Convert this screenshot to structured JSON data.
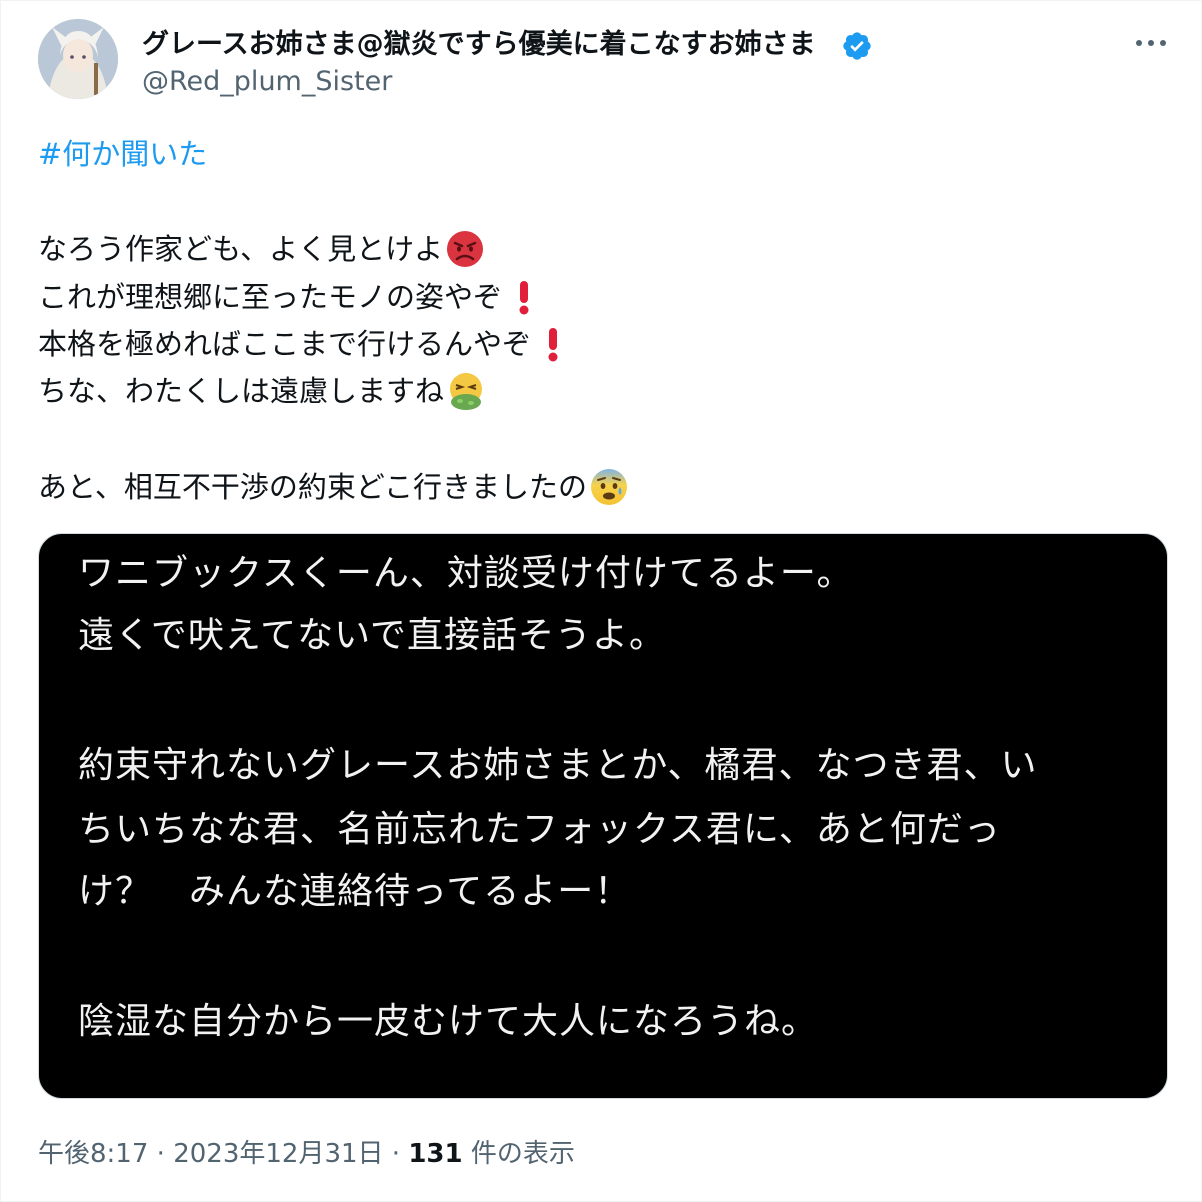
{
  "author": {
    "display_name": "グレースお姉さま@獄炎ですら優美に着こなすお姉さま",
    "handle": "@Red_plum_Sister",
    "verified": true
  },
  "tweet": {
    "hashtag": "#何か聞いた",
    "lines": [
      "なろう作家ども、よく見とけよ",
      "これが理想郷に至ったモノの姿やぞ",
      "本格を極めればここまで行けるんやぞ",
      "ちな、わたくしは遠慮しますね",
      "あと、相互不干渉の約束どこ行きましたの"
    ],
    "emojis": [
      "angry-face-emoji",
      "exclamation-emoji",
      "exclamation-emoji",
      "nauseated-face-emoji",
      "anxious-face-emoji"
    ]
  },
  "image_text": [
    "ワニブックスくーん、対談受け付けてるよー。",
    "遠くで吠えてないで直接話そうよ。",
    "約束守れないグレースお姉さまとか、橘君、なつき君、い",
    "ちいちなな君、名前忘れたフォックス君に、あと何だっ",
    "け？　みんな連絡待ってるよー！",
    "陰湿な自分から一皮むけて大人になろうね。"
  ],
  "meta": {
    "time": "午後8:17",
    "sep1": " · ",
    "date": "2023年12月31日",
    "sep2": " · ",
    "views_count": "131",
    "views_label": " 件の表示"
  },
  "colors": {
    "link": "#1d9bf0",
    "text": "#0f1419",
    "secondary": "#536471",
    "verified": "#1d9bf0"
  }
}
